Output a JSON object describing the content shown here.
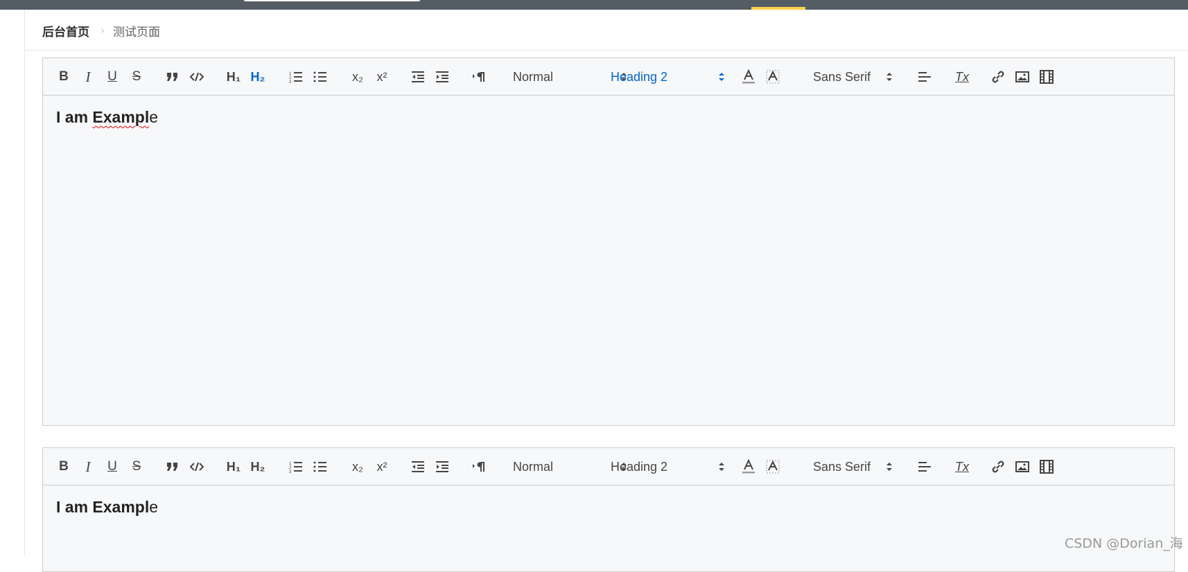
{
  "breadcrumb": {
    "home": "后台首页",
    "separator": "›",
    "current": "测试页面"
  },
  "editors": [
    {
      "content": {
        "bold_text": "I am Exampl",
        "tail": "e"
      },
      "pickers": {
        "size": "Normal",
        "header": "Heading 2",
        "font": "Sans Serif"
      },
      "active_header_label": "H₂"
    },
    {
      "content": {
        "bold_text": "I am Exampl",
        "tail": "e"
      },
      "pickers": {
        "size": "Normal",
        "header": "Heading 2",
        "font": "Sans Serif"
      }
    }
  ],
  "toolbar_labels": {
    "bold": "B",
    "italic": "I",
    "underline": "U",
    "strike": "S",
    "h1": "H₁",
    "h2": "H₂",
    "sub": "x₂",
    "sup": "x²",
    "clean": "Tx"
  },
  "watermark": "CSDN @Dorian_海",
  "colors": {
    "active": "#0066cc",
    "topbar": "#545c64",
    "accent": "#ffd04b"
  }
}
